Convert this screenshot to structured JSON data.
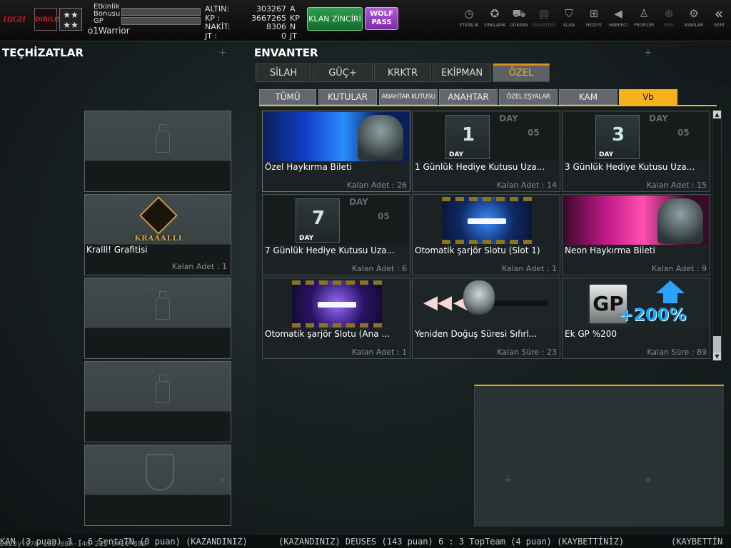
{
  "player": {
    "name": "o1Warrior",
    "event_bonus_label": "Etkinlik Bonusu",
    "gp_label": "GP",
    "logo_text": "HIGH",
    "logo_sub": "DIRILIS"
  },
  "currencies": [
    {
      "label": "ALTIN:",
      "value": "303267",
      "unit": "A"
    },
    {
      "label": "KP    :",
      "value": "3667265",
      "unit": "KP"
    },
    {
      "label": "NAKİT:",
      "value": "8306",
      "unit": "N"
    },
    {
      "label": "JT    :",
      "value": "0",
      "unit": "JT"
    }
  ],
  "buttons": {
    "klan_zinciri": "KLAN ZİNCİRİ",
    "wolf_pass_line1": "WOLF",
    "wolf_pass_line2": "PASS"
  },
  "top_icons": [
    {
      "label": "ETKİNLİK",
      "icon": "stopwatch-icon",
      "glyph": "◷"
    },
    {
      "label": "SIRALAMA",
      "icon": "medal-icon",
      "glyph": "✪"
    },
    {
      "label": "DÜKKAN",
      "icon": "cart-icon",
      "glyph": "⛟"
    },
    {
      "label": "ENVANTER",
      "icon": "inventory-icon",
      "glyph": "▤"
    },
    {
      "label": "KLAN",
      "icon": "shield-icon",
      "glyph": "⛉"
    },
    {
      "label": "HEDİYE",
      "icon": "gift-icon",
      "glyph": "⊞"
    },
    {
      "label": "HABERCİ",
      "icon": "megaphone-icon",
      "glyph": "◀"
    },
    {
      "label": "PROFİLİM",
      "icon": "profile-icon",
      "glyph": "♙"
    },
    {
      "label": "WEB",
      "icon": "globe-icon",
      "glyph": "⊕"
    },
    {
      "label": "AYARLAR",
      "icon": "gear-icon",
      "glyph": "⚙"
    },
    {
      "label": "GERİ",
      "icon": "back-icon",
      "glyph": "«"
    }
  ],
  "equipment": {
    "title": "TEÇHİZATLAR",
    "slots": [
      {
        "type": "spray-empty"
      },
      {
        "type": "item",
        "name": "Kralll! Grafitisi",
        "count": "Kalan Adet : 1",
        "emblem_text": "KRAAALLI"
      },
      {
        "type": "spray-empty"
      },
      {
        "type": "spray-empty"
      },
      {
        "type": "shield-empty"
      }
    ]
  },
  "inventory": {
    "title": "ENVANTER",
    "tabs": [
      "SİLAH",
      "GÜÇ+",
      "KRKTR",
      "EKİPMAN",
      "ÖZEL"
    ],
    "active_tab": "ÖZEL",
    "subtabs": [
      "TÜMÜ",
      "KUTULAR",
      "ANAHTAR KUTUSU",
      "ANAHTAR",
      "ÖZEL EŞYALAR",
      "KAM",
      "Vb"
    ],
    "active_subtab": "Vb",
    "items": [
      {
        "name": "Özel Haykırma Bileti",
        "count": "Kalan Adet : 26",
        "thumb": "blue-beam"
      },
      {
        "name": "1 Günlük Hediye Kutusu Uza...",
        "count": "Kalan Adet : 14",
        "thumb": "day",
        "day": "1"
      },
      {
        "name": "3 Günlük Hediye Kutusu Uza...",
        "count": "Kalan Adet : 15",
        "thumb": "day",
        "day": "3"
      },
      {
        "name": "7 Günlük Hediye Kutusu Uza...",
        "count": "Kalan Adet : 6",
        "thumb": "day",
        "day": "7"
      },
      {
        "name": "Otomatik şarjör Slotu (Slot 1)",
        "count": "Kalan Adet : 1",
        "thumb": "gun-blue"
      },
      {
        "name": "Neon Haykırma Bileti",
        "count": "Kalan Adet : 9",
        "thumb": "pink-beam"
      },
      {
        "name": "Otomatik şarjör Slotu (Ana ...",
        "count": "Kalan Adet : 1",
        "thumb": "gun-purple"
      },
      {
        "name": "Yeniden Doğuş Süresi Sıfırl...",
        "count": "Kalan Süre : 23",
        "thumb": "arrows"
      },
      {
        "name": "Ek GP %200",
        "count": "Kalan Süre : 89",
        "thumb": "gp",
        "gp_plus": "+200%"
      }
    ],
    "day_thumb": {
      "top": "DAY",
      "side": "05",
      "label": "DAY"
    }
  },
  "ticker": {
    "left": "KAN (3 puan) 3 : 6 SentaTN (0 puan) (KAZANDINIZ)",
    "middle": "(KAZANDINIZ) DEUSES (143 puan) 6 : 3 TopTeam (4 puan) (KAYBETTİNİZ)",
    "right": "(KAYBETTİN",
    "timestamp": "2025y-07m-10d-08h-14m-21s-0410-880"
  },
  "colors": {
    "accent_orange": "#f5b21d",
    "klan_green": "#2d9d4e",
    "wolf_purple": "#b25cd9"
  }
}
